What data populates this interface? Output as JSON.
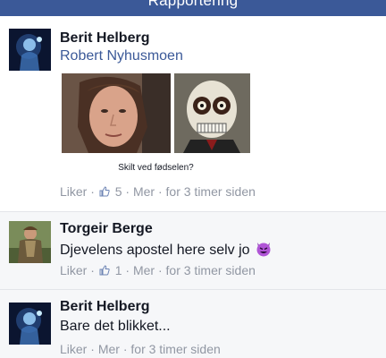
{
  "header": {
    "title": "Rapportering"
  },
  "comments": [
    {
      "author": "Berit Helberg",
      "text": "Robert Nyhusmoen",
      "image_caption": "Skilt ved fødselen?",
      "like_label": "Liker",
      "like_count": "5",
      "more_label": "Mer",
      "time": "for 3 timer siden"
    },
    {
      "author": "Torgeir Berge",
      "text": "Djevelens apostel here selv jo",
      "like_label": "Liker",
      "like_count": "1",
      "more_label": "Mer",
      "time": "for 3 timer siden"
    },
    {
      "author": "Berit Helberg",
      "text": "Bare det blikket...",
      "like_label": "Liker",
      "more_label": "Mer",
      "time": "for 3 timer siden"
    }
  ],
  "colors": {
    "brand": "#3b5998",
    "meta": "#9197a3"
  }
}
